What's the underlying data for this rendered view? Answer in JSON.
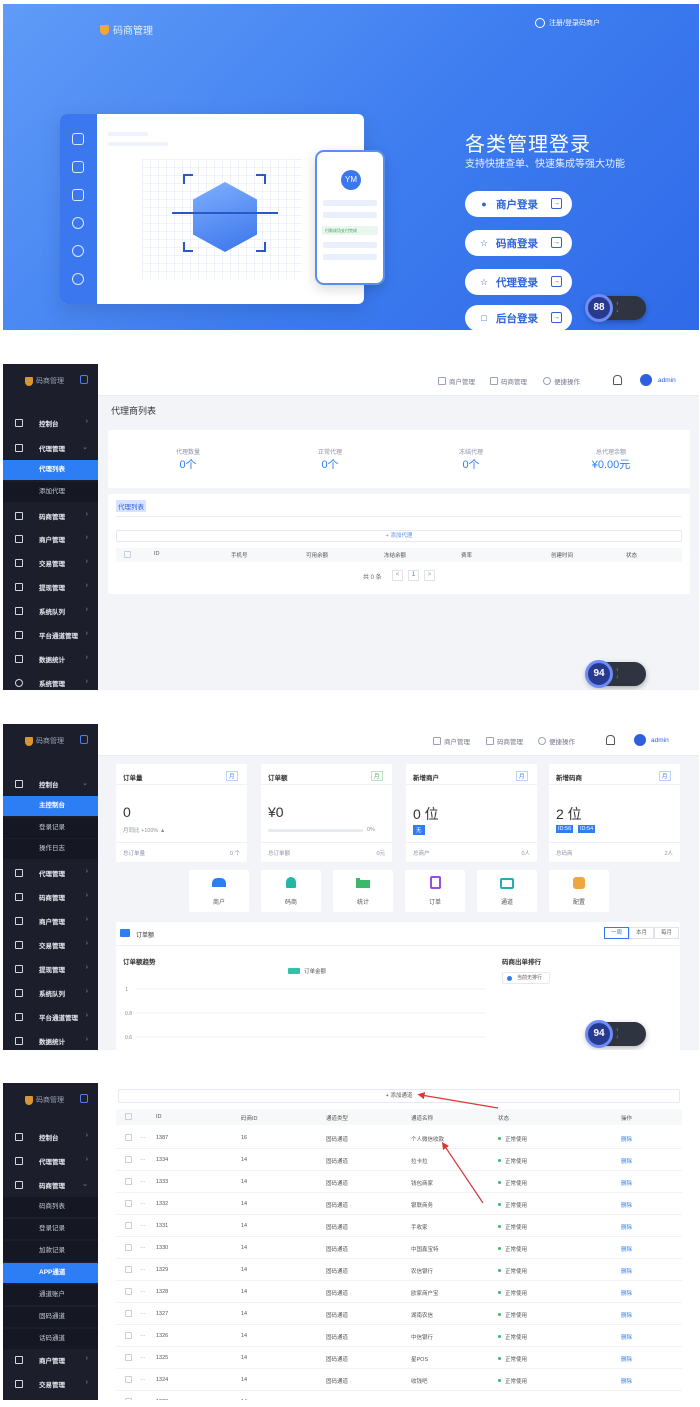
{
  "login": {
    "brand": "码商管理",
    "register": "注册/登录码商户",
    "mock_avatar": "YM",
    "mock_success": "付款成功支付完成",
    "title": "各类管理登录",
    "subtitle": "支持快捷查单、快速集成等强大功能",
    "buttons": [
      {
        "icon": "user-icon",
        "label": "商户登录"
      },
      {
        "icon": "star-icon",
        "label": "码商登录"
      },
      {
        "icon": "star-icon",
        "label": "代理登录"
      },
      {
        "icon": "monitor-icon",
        "label": "后台登录"
      }
    ],
    "speed_value": "88"
  },
  "header": {
    "brand": "码商管理",
    "links": [
      "商户管理",
      "码商管理",
      "便捷操作"
    ],
    "user": "admin"
  },
  "agents": {
    "menu": [
      {
        "label": "控制台"
      },
      {
        "label": "代理管理",
        "open": true,
        "children": [
          "代理列表",
          "添加代理"
        ],
        "active_child": "代理列表"
      },
      {
        "label": "码商管理"
      },
      {
        "label": "商户管理"
      },
      {
        "label": "交易管理"
      },
      {
        "label": "提现管理"
      },
      {
        "label": "系统队列"
      },
      {
        "label": "平台通道管理"
      },
      {
        "label": "数据统计"
      },
      {
        "label": "系统管理"
      }
    ],
    "page_title": "代理商列表",
    "stats": [
      {
        "label": "代理数量",
        "value": "0个"
      },
      {
        "label": "正常代理",
        "value": "0个"
      },
      {
        "label": "冻结代理",
        "value": "0个"
      },
      {
        "label": "总代理余额",
        "value": "¥0.00元"
      }
    ],
    "section_tab": "代理列表",
    "add_button": "+ 添加代理",
    "columns": [
      "ID",
      "手机号",
      "可用余额",
      "冻结余额",
      "费率",
      "创建时间",
      "状态"
    ],
    "pagination": {
      "total": "共 0 条",
      "prev": "<",
      "page": "1",
      "next": ">"
    },
    "speed_value": "94"
  },
  "dashboard": {
    "menu": [
      {
        "label": "控制台",
        "open": true,
        "children": [
          "主控制台",
          "登录记录",
          "操作日志"
        ],
        "active_child": "主控制台"
      },
      {
        "label": "代理管理"
      },
      {
        "label": "码商管理"
      },
      {
        "label": "商户管理"
      },
      {
        "label": "交易管理"
      },
      {
        "label": "提现管理"
      },
      {
        "label": "系统队列"
      },
      {
        "label": "平台通道管理"
      },
      {
        "label": "数据统计"
      }
    ],
    "cards": [
      {
        "title": "订单量",
        "tag": "月",
        "value": "0",
        "sub": "月同比 +100% ▲",
        "foot_label": "总订单量",
        "foot_value": "0 个"
      },
      {
        "title": "订单额",
        "tag": "月",
        "value": "¥0",
        "progress_percent": 0,
        "progress_label": "0%",
        "foot_label": "总订单额",
        "foot_value": "0元"
      },
      {
        "title": "新增商户",
        "tag": "月",
        "value": "0 位",
        "badge": "无",
        "foot_label": "总商户",
        "foot_value": "0人"
      },
      {
        "title": "新增码商",
        "tag": "月",
        "value": "2 位",
        "badges": [
          "ID:56",
          "ID:54"
        ],
        "foot_label": "总码商",
        "foot_value": "2人"
      }
    ],
    "shortcuts": [
      "商户",
      "码商",
      "统计",
      "订单",
      "通道",
      "配置"
    ],
    "chart_section": "订单额",
    "range_tabs": [
      "一周",
      "本月",
      "每月"
    ],
    "active_range": "一周",
    "trend_title": "订单额趋势",
    "legend": "订单金额",
    "chart_data": {
      "type": "line",
      "title": "订单额趋势",
      "series": [
        {
          "name": "订单金额",
          "values": []
        }
      ],
      "y_ticks": [
        "1",
        "0.8",
        "0.6"
      ]
    },
    "ranking_title": "码商出单排行",
    "ranking_empty": "当前无排行",
    "speed_value": "94"
  },
  "channels": {
    "menu": [
      {
        "label": "控制台"
      },
      {
        "label": "代理管理"
      },
      {
        "label": "码商管理",
        "open": true,
        "children": [
          "码商列表",
          "登录记录",
          "加款记录",
          "APP通道",
          "通道账户",
          "固码通道",
          "话码通道"
        ],
        "active_child": "APP通道"
      },
      {
        "label": "商户管理"
      },
      {
        "label": "交易管理"
      }
    ],
    "add_button": "+ 添加通道",
    "columns": [
      "ID",
      "码商ID",
      "通道类型",
      "通道名称",
      "状态",
      "操作"
    ],
    "rows": [
      {
        "id": "1387",
        "ms": "16",
        "type": "固码通道",
        "name": "个人微信收款",
        "status": "正常使用",
        "op": "删除"
      },
      {
        "id": "1334",
        "ms": "14",
        "type": "固码通道",
        "name": "拉卡拉",
        "status": "正常使用",
        "op": "删除"
      },
      {
        "id": "1333",
        "ms": "14",
        "type": "固码通道",
        "name": "钱包商家",
        "status": "正常使用",
        "op": "删除"
      },
      {
        "id": "1332",
        "ms": "14",
        "type": "固码通道",
        "name": "银联商务",
        "status": "正常使用",
        "op": "删除"
      },
      {
        "id": "1331",
        "ms": "14",
        "type": "固码通道",
        "name": "手收家",
        "status": "正常使用",
        "op": "删除"
      },
      {
        "id": "1330",
        "ms": "14",
        "type": "固码通道",
        "name": "中国鑫宝特",
        "status": "正常使用",
        "op": "删除"
      },
      {
        "id": "1329",
        "ms": "14",
        "type": "固码通道",
        "name": "农信银行",
        "status": "正常使用",
        "op": "删除"
      },
      {
        "id": "1328",
        "ms": "14",
        "type": "固码通道",
        "name": "欧家商户宝",
        "status": "正常使用",
        "op": "删除"
      },
      {
        "id": "1327",
        "ms": "14",
        "type": "固码通道",
        "name": "湖南农信",
        "status": "正常使用",
        "op": "删除"
      },
      {
        "id": "1326",
        "ms": "14",
        "type": "固码通道",
        "name": "中信银行",
        "status": "正常使用",
        "op": "删除"
      },
      {
        "id": "1325",
        "ms": "14",
        "type": "固码通道",
        "name": "星POS",
        "status": "正常使用",
        "op": "删除"
      },
      {
        "id": "1324",
        "ms": "14",
        "type": "固码通道",
        "name": "收钱吧",
        "status": "正常使用",
        "op": "删除"
      },
      {
        "id": "1323",
        "ms": "14",
        "type": "固码通道",
        "name": "云闪付",
        "status": "正常使用",
        "op": "删除"
      }
    ]
  }
}
